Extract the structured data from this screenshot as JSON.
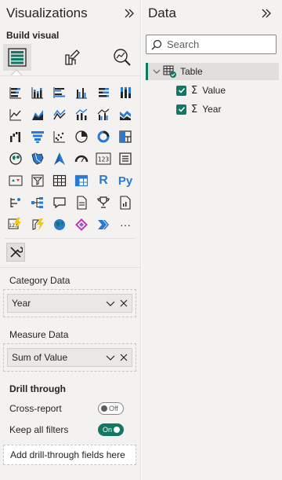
{
  "visualizations": {
    "title": "Visualizations",
    "build_visual_label": "Build visual",
    "modes": [
      {
        "name": "build-visual-icon",
        "active": true
      },
      {
        "name": "format-visual-icon",
        "active": false
      },
      {
        "name": "analytics-icon",
        "active": false
      }
    ],
    "visual_icons": [
      "stacked-bar-chart",
      "stacked-column-chart",
      "clustered-bar-chart",
      "clustered-column-chart",
      "100-stacked-bar-chart",
      "100-stacked-column-chart",
      "line-chart",
      "area-chart",
      "stacked-area-chart",
      "line-and-stacked-column-chart",
      "line-and-clustered-column-chart",
      "ribbon-chart",
      "waterfall-chart",
      "funnel-chart",
      "scatter-chart",
      "pie-chart",
      "donut-chart",
      "treemap",
      "map",
      "filled-map",
      "azure-map",
      "gauge",
      "card",
      "multi-row-card",
      "kpi",
      "slicer",
      "table",
      "matrix",
      "r-script-visual",
      "python-visual",
      "key-influencers",
      "decomposition-tree",
      "qna",
      "smart-narrative",
      "metrics",
      "paginated-report",
      "power-apps",
      "power-automate",
      "arcgis-map",
      "power-bi-visual",
      "get-more-visuals",
      "more-options"
    ],
    "text_glyphs": {
      "card": "123",
      "r": "R",
      "py": "Py",
      "more": "···"
    },
    "wells": {
      "category_label": "Category Data",
      "category_field": "Year",
      "measure_label": "Measure Data",
      "measure_field": "Sum of Value"
    },
    "drill_through": {
      "title": "Drill through",
      "cross_report_label": "Cross-report",
      "cross_report_state": "Off",
      "keep_filters_label": "Keep all filters",
      "keep_filters_state": "On",
      "add_fields_label": "Add drill-through fields here"
    }
  },
  "data_pane": {
    "title": "Data",
    "search_placeholder": "Search",
    "table": {
      "name": "Table",
      "fields": [
        {
          "name": "Value",
          "checked": true
        },
        {
          "name": "Year",
          "checked": true
        }
      ]
    }
  },
  "colors": {
    "accent": "#117865",
    "blue": "#2b79d0",
    "icon_dark": "#252423",
    "pane_bg": "#f3f2f1"
  }
}
